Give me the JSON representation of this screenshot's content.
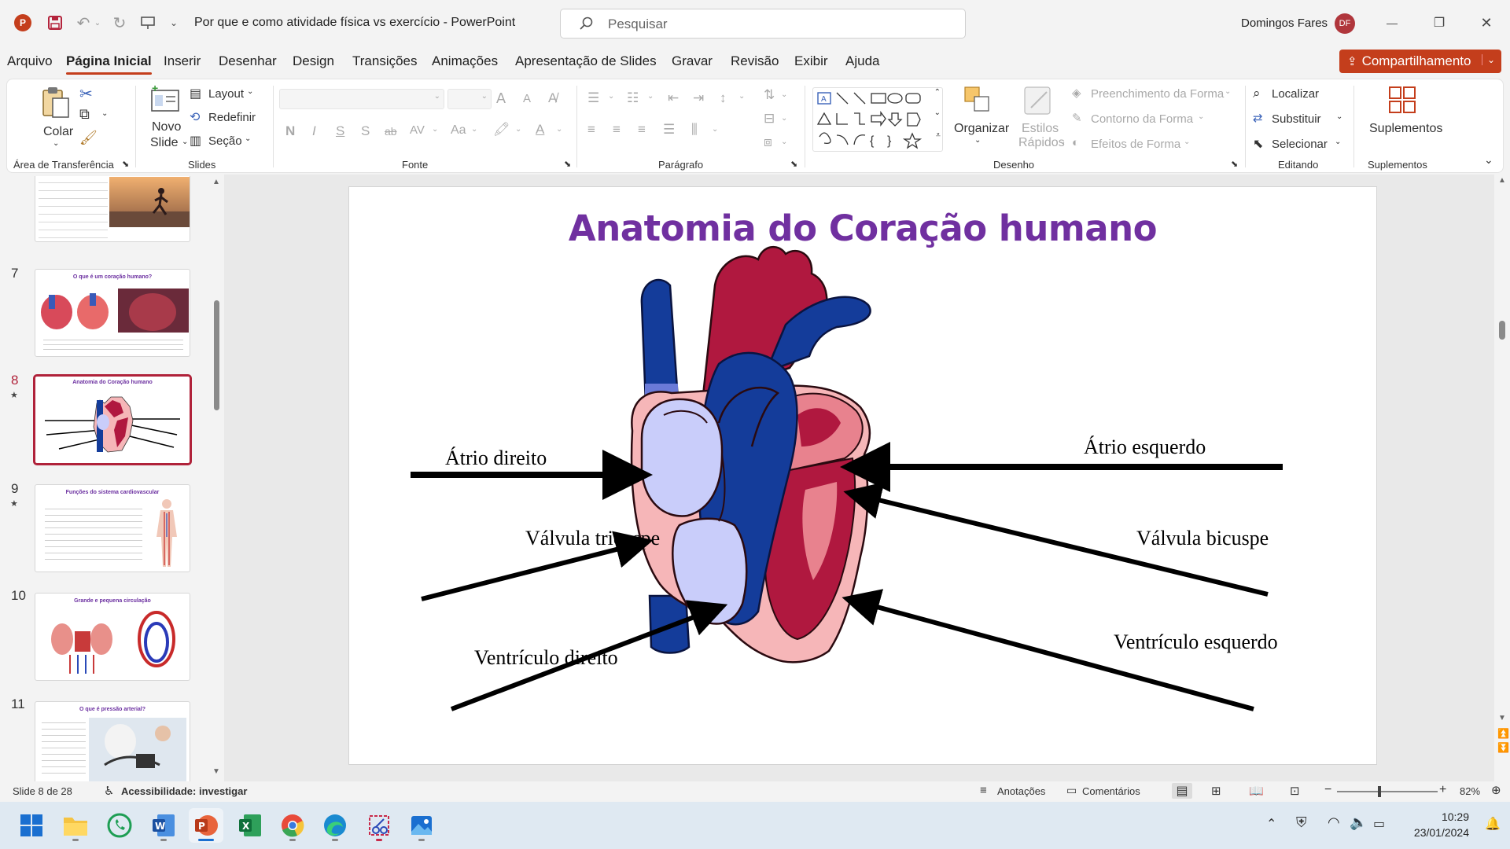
{
  "window": {
    "title": "Por que e como atividade física vs exercício  -  PowerPoint",
    "search_placeholder": "Pesquisar",
    "user_name": "Domingos Fares",
    "user_initials": "DF",
    "minimize": "—",
    "maximize": "❐",
    "close": "✕"
  },
  "menu": {
    "items": [
      "Arquivo",
      "Página Inicial",
      "Inserir",
      "Desenhar",
      "Design",
      "Transições",
      "Animações",
      "Apresentação de Slides",
      "Gravar",
      "Revisão",
      "Exibir",
      "Ajuda"
    ],
    "active": "Página Inicial",
    "share_label": "Compartilhamento"
  },
  "ribbon": {
    "clipboard": {
      "paste": "Colar",
      "group": "Área de Transferência"
    },
    "slides": {
      "new_slide_1": "Novo",
      "new_slide_2": "Slide",
      "layout": "Layout",
      "reset": "Redefinir",
      "section": "Seção",
      "group": "Slides"
    },
    "font": {
      "group": "Fonte",
      "bold": "N",
      "italic": "I",
      "underline": "S",
      "shadow": "S",
      "strike": "ab",
      "spacing": "AV",
      "case": "Aa",
      "grow": "A",
      "shrink": "A",
      "color": "A"
    },
    "paragraph": {
      "group": "Parágrafo"
    },
    "drawing": {
      "arrange": "Organizar",
      "quick_styles_1": "Estilos",
      "quick_styles_2": "Rápidos",
      "fill": "Preenchimento da Forma",
      "outline": "Contorno da Forma",
      "effects": "Efeitos de Forma",
      "group": "Desenho"
    },
    "editing": {
      "find": "Localizar",
      "replace": "Substituir",
      "select": "Selecionar",
      "group": "Editando"
    },
    "addins": {
      "label": "Suplementos",
      "group": "Suplementos"
    }
  },
  "thumbnails": [
    {
      "number": "7",
      "title": "O que é um coração humano?",
      "starred": false
    },
    {
      "number": "8",
      "title": "Anatomia do Coração humano",
      "starred": true,
      "selected": true
    },
    {
      "number": "9",
      "title": "Funções do sistema cardiovascular",
      "starred": true
    },
    {
      "number": "10",
      "title": "Grande e pequena circulação",
      "starred": false
    },
    {
      "number": "11",
      "title": "O que é pressão arterial?",
      "starred": false
    }
  ],
  "slide": {
    "title": "Anatomia do Coração humano",
    "labels": {
      "atrio_direito": "Átrio direito",
      "atrio_esquerdo": "Átrio esquerdo",
      "valvula_tricuspe": "Válvula tricuspe",
      "valvula_bicuspe": "Válvula bicuspe",
      "ventriculo_direito": "Ventrículo direito",
      "ventriculo_esquerdo": "Ventrículo esquerdo"
    }
  },
  "status": {
    "slide_info": "Slide 8 de 28",
    "accessibility": "Acessibilidade: investigar",
    "notes": "Anotações",
    "comments": "Comentários",
    "zoom": "82%",
    "zoom_fraction": 0.41
  },
  "taskbar": {
    "time": "10:29",
    "date": "23/01/2024",
    "apps": [
      "windows-start",
      "file-explorer",
      "whatsapp",
      "word",
      "powerpoint",
      "excel",
      "chrome",
      "edge",
      "snipping-tool",
      "photos"
    ]
  },
  "colors": {
    "accent": "#c43e1c",
    "title_purple": "#7030a0",
    "selection": "#b0223a",
    "heart_red": "#b0183f",
    "heart_blue": "#143c9a",
    "heart_pink": "#f6b6b8",
    "heart_lavender": "#c9cdfa"
  }
}
